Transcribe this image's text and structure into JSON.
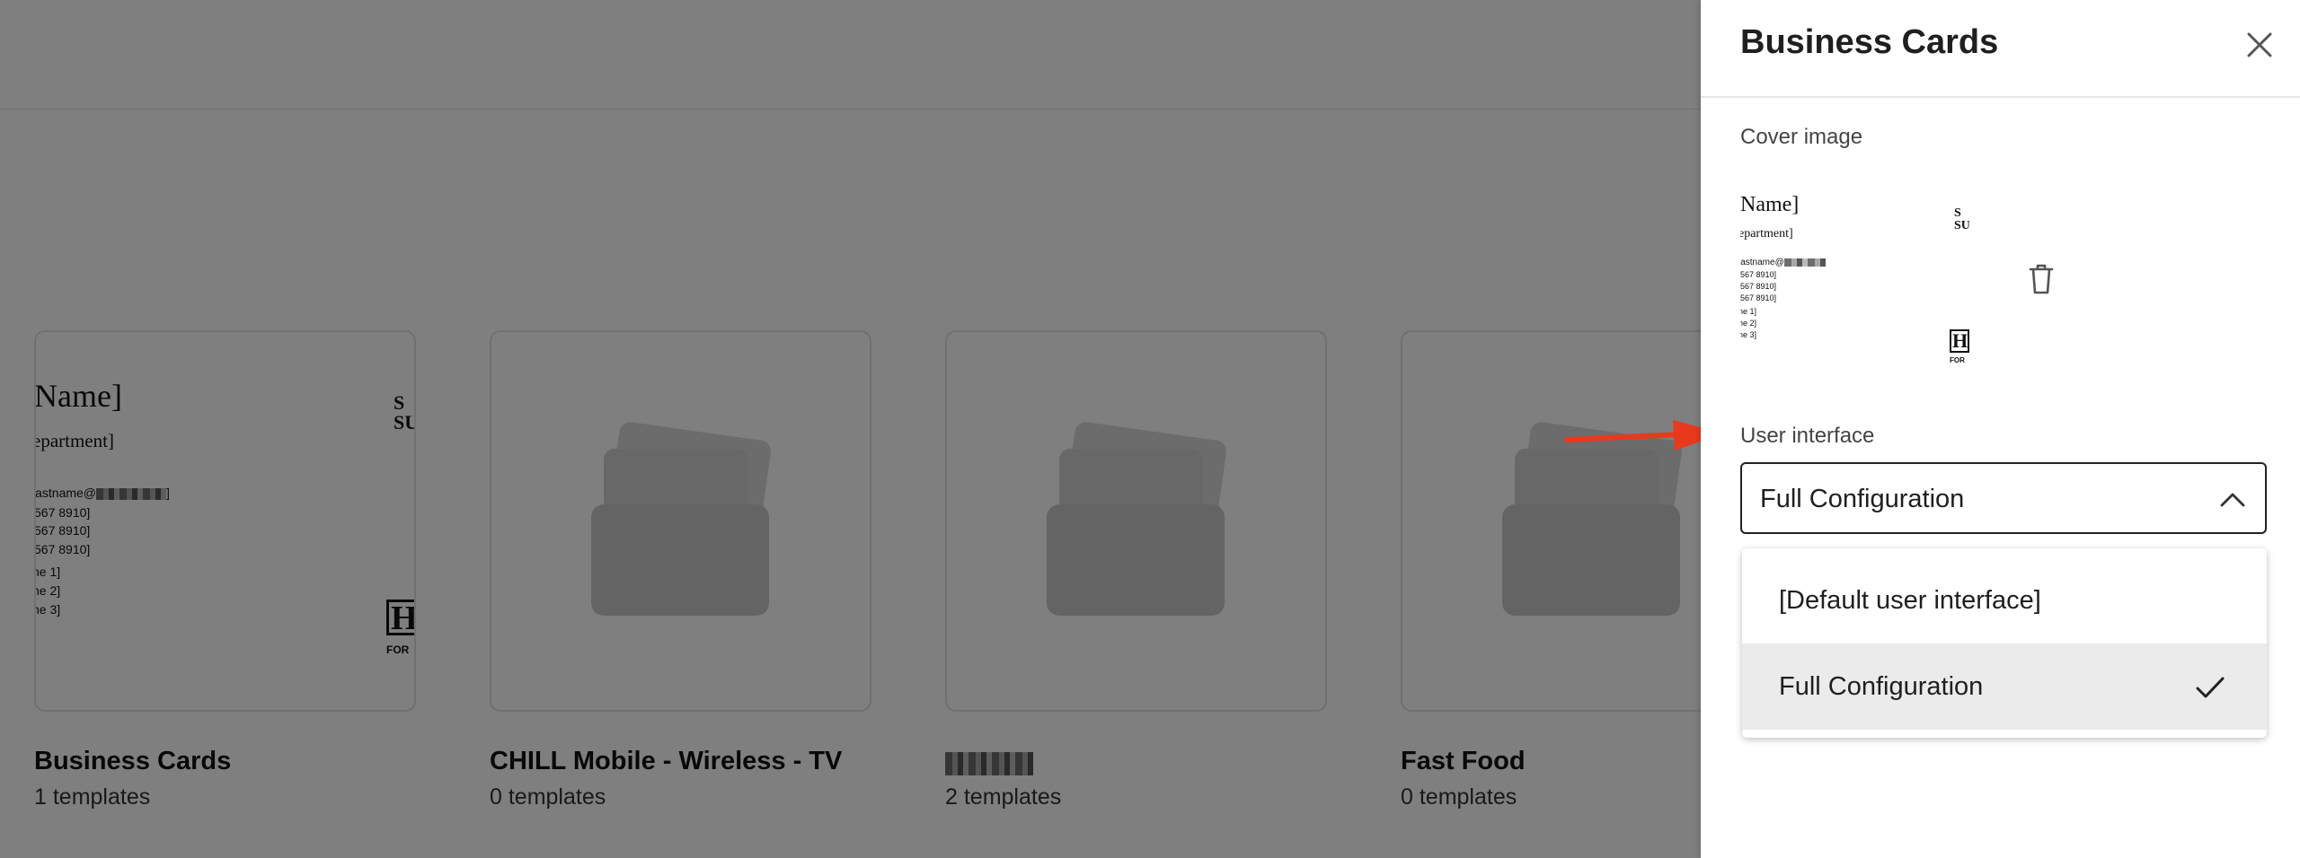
{
  "panel": {
    "title": "Business Cards",
    "cover_label": "Cover image",
    "ui_label": "User interface",
    "selected_value": "Full Configuration",
    "options": [
      {
        "label": "[Default user interface]",
        "selected": false
      },
      {
        "label": "Full Configuration",
        "selected": true
      }
    ],
    "icons": {
      "close": "close-icon",
      "delete": "trash-icon",
      "chevron": "chevron-up-icon",
      "check": "check-icon"
    }
  },
  "cards": [
    {
      "title": "Business Cards",
      "count": "1 templates"
    },
    {
      "title": "CHILL Mobile - Wireless - TV",
      "count": "0 templates"
    },
    {
      "title": "",
      "count": "2 templates"
    },
    {
      "title": "Fast Food",
      "count": "0 templates"
    }
  ],
  "business_card_preview": {
    "name": "Name]",
    "department": "epartment]",
    "email": "lastname@",
    "email_end": "]",
    "phone1": "567 8910]",
    "phone2": "567 8910]",
    "phone3": "567 8910]",
    "line1": "ne 1]",
    "line2": "ne 2]",
    "line3": "ne 3]",
    "logo_top": "S\nSU",
    "logo_bottom": "H",
    "logo_sub": "FOR"
  },
  "colors": {
    "overlay": "rgba(0,0,0,0.5)",
    "annotation_arrow": "#e8391d",
    "selected_option_bg": "#ebebeb"
  }
}
